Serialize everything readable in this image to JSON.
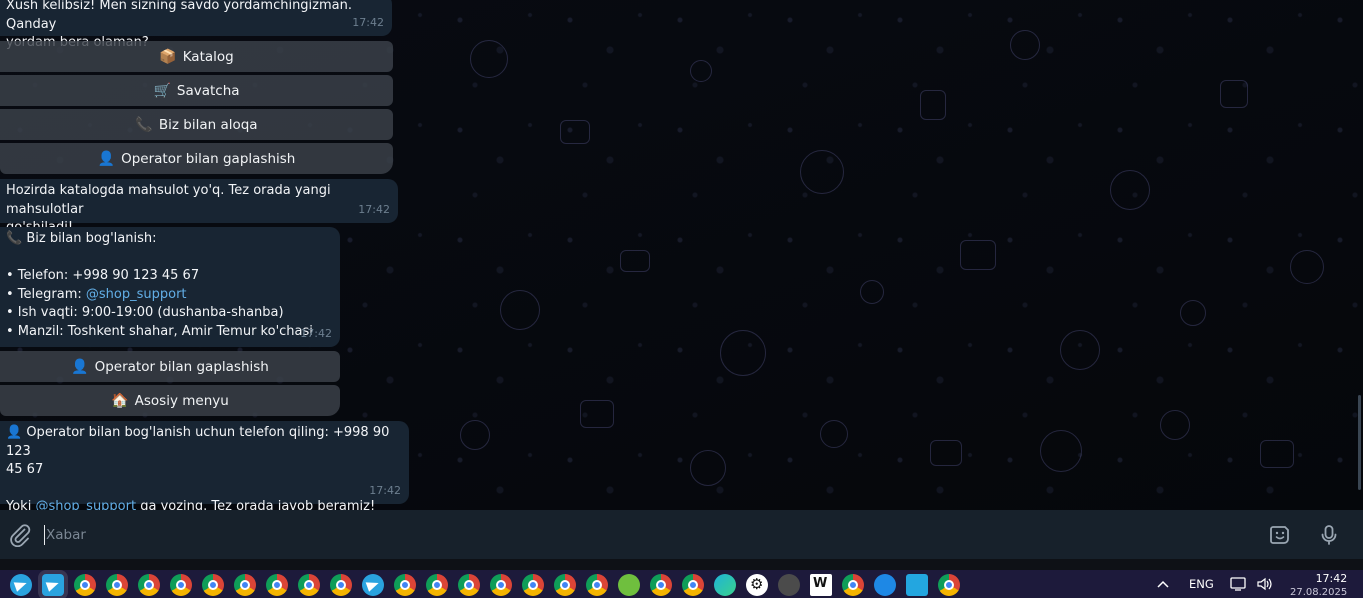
{
  "messages": {
    "greeting": {
      "text_line1": "Xush kelibsiz! Men sizning savdo yordamchingizman. Qanday",
      "text_line2": "yordam bera olaman?",
      "time": "17:42"
    },
    "keyboard1": [
      {
        "icon": "📦",
        "label": "Katalog"
      },
      {
        "icon": "🛒",
        "label": "Savatcha"
      },
      {
        "icon": "📞",
        "label": "Biz bilan aloqa"
      },
      {
        "icon": "👤",
        "label": "Operator bilan gaplashish"
      }
    ],
    "catalog_empty": {
      "text_line1": "Hozirda katalogda mahsulot yo'q. Tez orada yangi mahsulotlar",
      "text_line2": "qo'shiladi!",
      "time": "17:42"
    },
    "contact": {
      "icon": "📞",
      "heading": "Biz bilan bog'lanish:",
      "phone": "• Telefon: +998 90 123 45 67",
      "telegram_prefix": "• Telegram: ",
      "telegram_link": "@shop_support",
      "hours": "• Ish vaqti: 9:00-19:00 (dushanba-shanba)",
      "address": "• Manzil: Toshkent shahar, Amir Temur ko'chasi",
      "time": "17:42"
    },
    "keyboard2": [
      {
        "icon": "👤",
        "label": "Operator bilan gaplashish"
      },
      {
        "icon": "🏠",
        "label": "Asosiy menyu"
      }
    ],
    "operator": {
      "icon": "👤",
      "line1": "Operator bilan bog'lanish uchun telefon qiling: +998 90 123",
      "line2": "45 67",
      "line3_prefix": "Yoki ",
      "line3_link": "@shop_support",
      "line3_suffix": " ga yozing. Tez orada javob beramiz!",
      "time": "17:42"
    }
  },
  "input": {
    "placeholder": "Xabar",
    "value": ""
  },
  "taskbar": {
    "language": "ENG",
    "time": "17:42",
    "date": "27.08.2025"
  },
  "colors": {
    "bubble": "#182533",
    "link": "#62aee6",
    "input_bar": "#17212b",
    "taskbar": "#1d1a3b"
  }
}
